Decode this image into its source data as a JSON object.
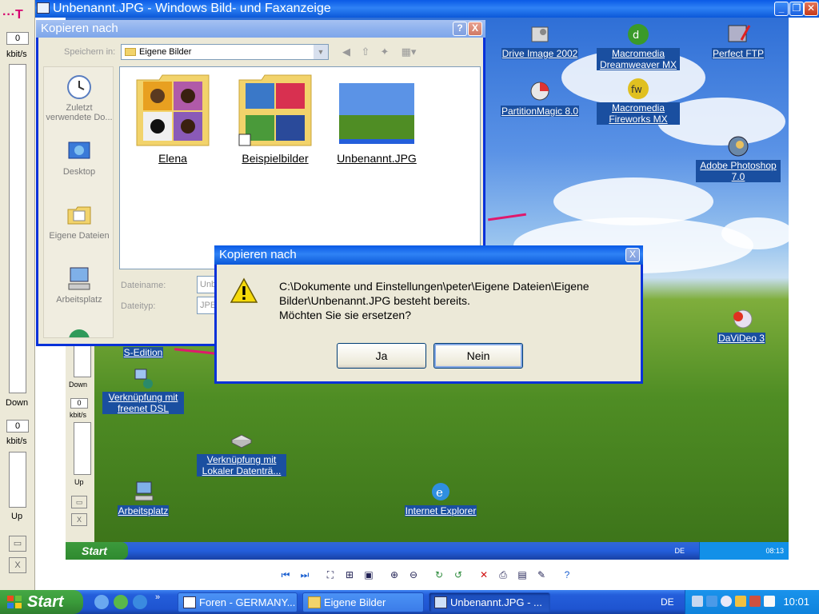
{
  "viewer": {
    "title": "Unbenannt.JPG - Windows Bild- und Faxanzeige",
    "strip": {
      "down_value": "0",
      "down_unit": "kbit/s",
      "down_label": "Down",
      "up_value": "0",
      "up_unit": "kbit/s",
      "up_label": "Up",
      "close_glyph": "X"
    }
  },
  "inner_desktop": {
    "icons": [
      {
        "label": "Drive Image 2002"
      },
      {
        "label": "Macromedia Dreamweaver MX"
      },
      {
        "label": "Perfect FTP"
      },
      {
        "label": "PartitionMagic 8.0"
      },
      {
        "label": "Macromedia Fireworks MX"
      },
      {
        "label": "Adobe Photoshop 7.0"
      },
      {
        "label": "DaViDeo 3"
      },
      {
        "label": "S-Edition"
      },
      {
        "label": "Verknüpfung mit freenet DSL"
      },
      {
        "label": "Verknüpfung mit Lokaler Datenträ..."
      },
      {
        "label": "Arbeitsplatz"
      },
      {
        "label": "Internet Explorer"
      }
    ],
    "strip": {
      "value": "0",
      "unit": "kbit/s",
      "down_label": "Down",
      "up_label": "Up",
      "close_glyph": "X"
    },
    "taskbar": {
      "start_label": "Start",
      "lang": "DE",
      "clock": "08:13"
    }
  },
  "save_dialog": {
    "title": "Kopieren nach",
    "help_glyph": "?",
    "close_glyph": "X",
    "save_in_label": "Speichern in:",
    "save_in_value": "Eigene Bilder",
    "places": [
      {
        "label": "Zuletzt verwendete Do..."
      },
      {
        "label": "Desktop"
      },
      {
        "label": "Eigene Dateien"
      },
      {
        "label": "Arbeitsplatz"
      }
    ],
    "files": [
      {
        "label": "Elena"
      },
      {
        "label": "Beispielbilder"
      },
      {
        "label": "Unbenannt.JPG"
      }
    ],
    "filename_label": "Dateiname:",
    "filename_value": "Unb",
    "filetype_label": "Dateityp:",
    "filetype_value": "JPE"
  },
  "confirm_dialog": {
    "title": "Kopieren nach",
    "close_glyph": "X",
    "message_line1": "C:\\Dokumente und Einstellungen\\peter\\Eigene Dateien\\Eigene",
    "message_line2": "Bilder\\Unbenannt.JPG besteht bereits.",
    "message_line3": "Möchten Sie sie ersetzen?",
    "yes_label": "Ja",
    "no_label": "Nein"
  },
  "taskbar": {
    "start_label": "Start",
    "tasks": [
      {
        "label": "Foren - GERMANY..."
      },
      {
        "label": "Eigene Bilder"
      },
      {
        "label": "Unbenannt.JPG - ..."
      }
    ],
    "lang": "DE",
    "clock": "10:01"
  },
  "colors": {
    "xp_blue": "#0a5ae6",
    "start_green": "#3a9b3a",
    "tray_blue": "#0e82dc",
    "dialog_face": "#ece9d8",
    "warning_yellow": "#f5d90a"
  }
}
